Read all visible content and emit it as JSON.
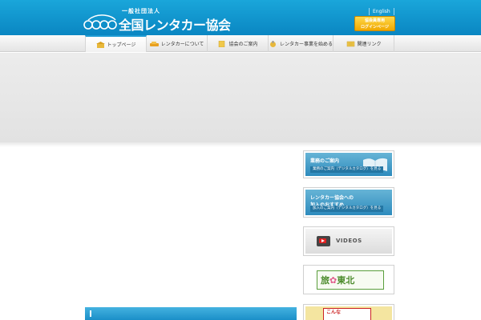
{
  "header": {
    "org_prefix": "一般社団法人",
    "org_name": "全国レンタカー協会",
    "tagline_1": "",
    "tagline_2": "",
    "language_link": "English",
    "member_button": [
      "協会員専用",
      "ログインページ"
    ]
  },
  "nav": {
    "items": [
      {
        "label": "トップページ",
        "icon": "home-icon"
      },
      {
        "label": "レンタカーについて",
        "icon": "car-icon"
      },
      {
        "label": "協会のご案内",
        "icon": "document-icon"
      },
      {
        "label": "レンタカー事業を始める",
        "icon": "start-icon"
      },
      {
        "label": "関連リンク",
        "icon": "link-icon"
      }
    ]
  },
  "banners": {
    "business": {
      "title": "業務のご案内",
      "sub": "業務のご案内（デジタルカタログ）を見る"
    },
    "join": {
      "title_1": "レンタカー協会への",
      "title_2": "加入のおすすめ",
      "sub": "加入のご案内（デジタルカタログ）を見る"
    },
    "videos": {
      "label": "VIDEOS"
    },
    "tohoku": {
      "main_1": "旅",
      "main_2": "東北",
      "sub": ""
    },
    "konna": {
      "line_1": "こんな",
      "line_2": ""
    }
  },
  "news": {
    "label": ""
  },
  "colors": {
    "header_blue": "#0a86c2",
    "accent_blue": "#1f9bd3",
    "gold": "#f0a800"
  }
}
